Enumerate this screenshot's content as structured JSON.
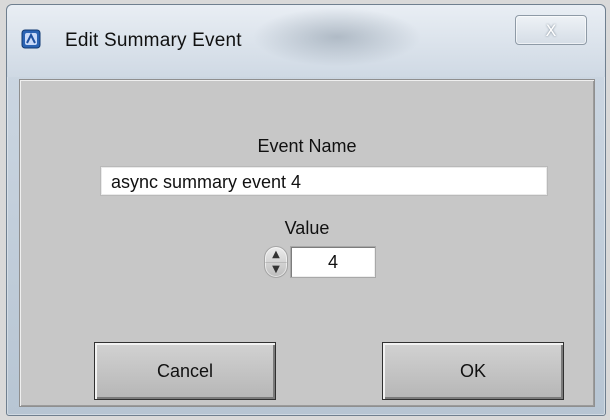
{
  "window": {
    "title": "Edit Summary Event",
    "close_glyph": "X",
    "app_icon": "labview-vi-icon"
  },
  "form": {
    "event_name_label": "Event Name",
    "event_name_value": "async summary event 4",
    "value_label": "Value",
    "value": "4",
    "spinner_icon_up": "chevron-up-icon",
    "spinner_icon_down": "chevron-down-icon"
  },
  "buttons": {
    "cancel_label": "Cancel",
    "ok_label": "OK"
  },
  "colors": {
    "panel_gray": "#c7c7c7",
    "window_blue": "#cfd9e4"
  }
}
